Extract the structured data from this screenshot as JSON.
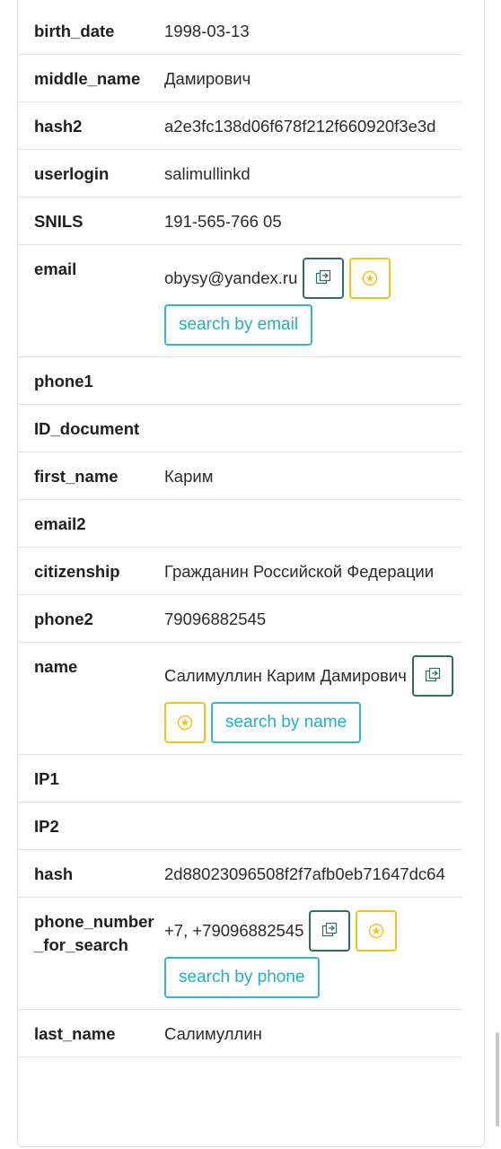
{
  "rows": [
    {
      "key": "birth_date",
      "value": "1998-03-13"
    },
    {
      "key": "middle_name",
      "value": "Дамирович"
    },
    {
      "key": "hash2",
      "value": "a2e3fc138d06f678f212f660920f3e3d"
    },
    {
      "key": "userlogin",
      "value": "salimullinkd"
    },
    {
      "key": "SNILS",
      "value": "191-565-766 05"
    },
    {
      "key": "email",
      "value": "obysy@yandex.ru",
      "search_label": "search by email"
    },
    {
      "key": "phone1",
      "value": ""
    },
    {
      "key": "ID_document",
      "value": ""
    },
    {
      "key": "first_name",
      "value": "Карим"
    },
    {
      "key": "email2",
      "value": ""
    },
    {
      "key": "citizenship",
      "value": "Гражданин Российской Федерации"
    },
    {
      "key": "phone2",
      "value": "79096882545"
    },
    {
      "key": "name",
      "value": "Салимуллин Карим Дамирович",
      "search_label": "search by name"
    },
    {
      "key": "IP1",
      "value": ""
    },
    {
      "key": "IP2",
      "value": ""
    },
    {
      "key": "hash",
      "value": "2d88023096508f2f7afb0eb71647dc64"
    },
    {
      "key": "phone_number_for_search",
      "value": "+7, +79096882545",
      "search_label": "search by phone"
    },
    {
      "key": "last_name",
      "value": "Салимуллин"
    }
  ],
  "icons": {
    "copy": "copy-icon",
    "star": "star-icon"
  },
  "colors": {
    "copy_border": "#2f6f63",
    "star_border": "#f0c419",
    "search_border": "#35b7c9",
    "search_text": "#1fb1c6"
  }
}
